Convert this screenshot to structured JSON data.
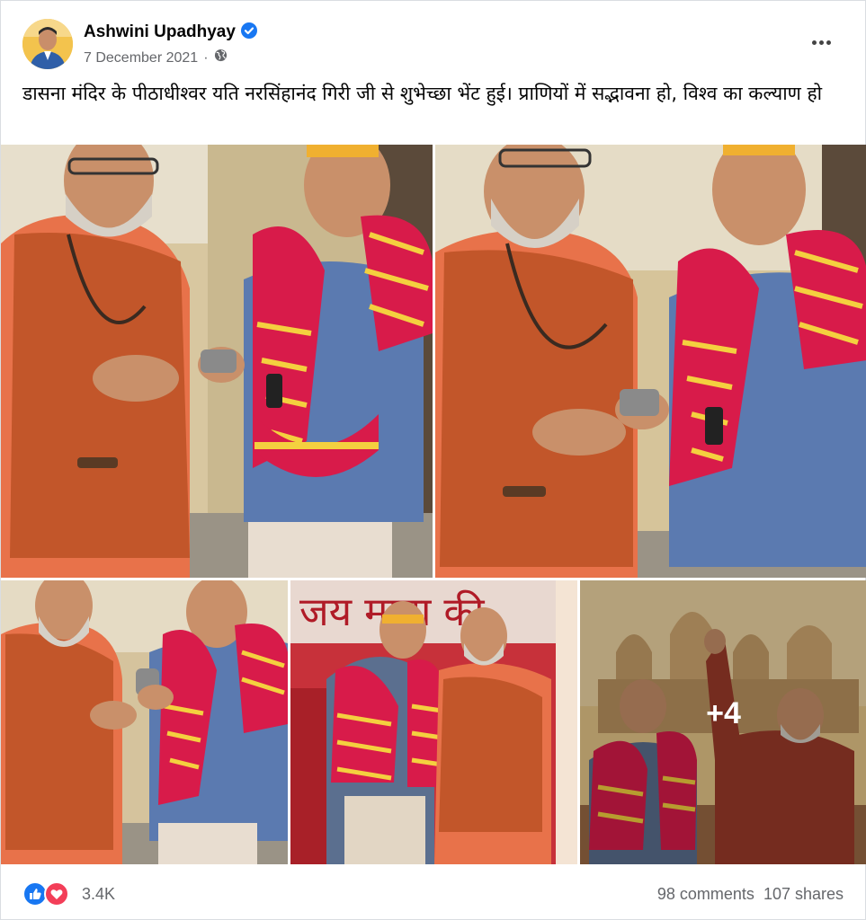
{
  "post": {
    "author": "Ashwini Upadhyay",
    "date": "7 December 2021",
    "separator": "·",
    "caption": "डासना मंदिर के पीठाधीश्वर यति नरसिंहानंद गिरी जी से शुभेच्छा भेंट हुई। प्राणियों में सद्भावना हो, विश्व का कल्याण हो"
  },
  "gallery": {
    "more_count": "+4"
  },
  "footer": {
    "reaction_count": "3.4K",
    "comments": "98 comments",
    "shares": "107 shares"
  },
  "colors": {
    "accent": "#1877f2",
    "like": "#1877f2",
    "love": "#f33e58",
    "saffron": "#e8603a",
    "vest": "#c2562a",
    "shirt_blue": "#5b7ab0",
    "scarf_red": "#d81b4a"
  },
  "icons": [
    "verified-badge-icon",
    "public-globe-icon",
    "more-options-icon",
    "like-reaction-icon",
    "love-reaction-icon"
  ]
}
